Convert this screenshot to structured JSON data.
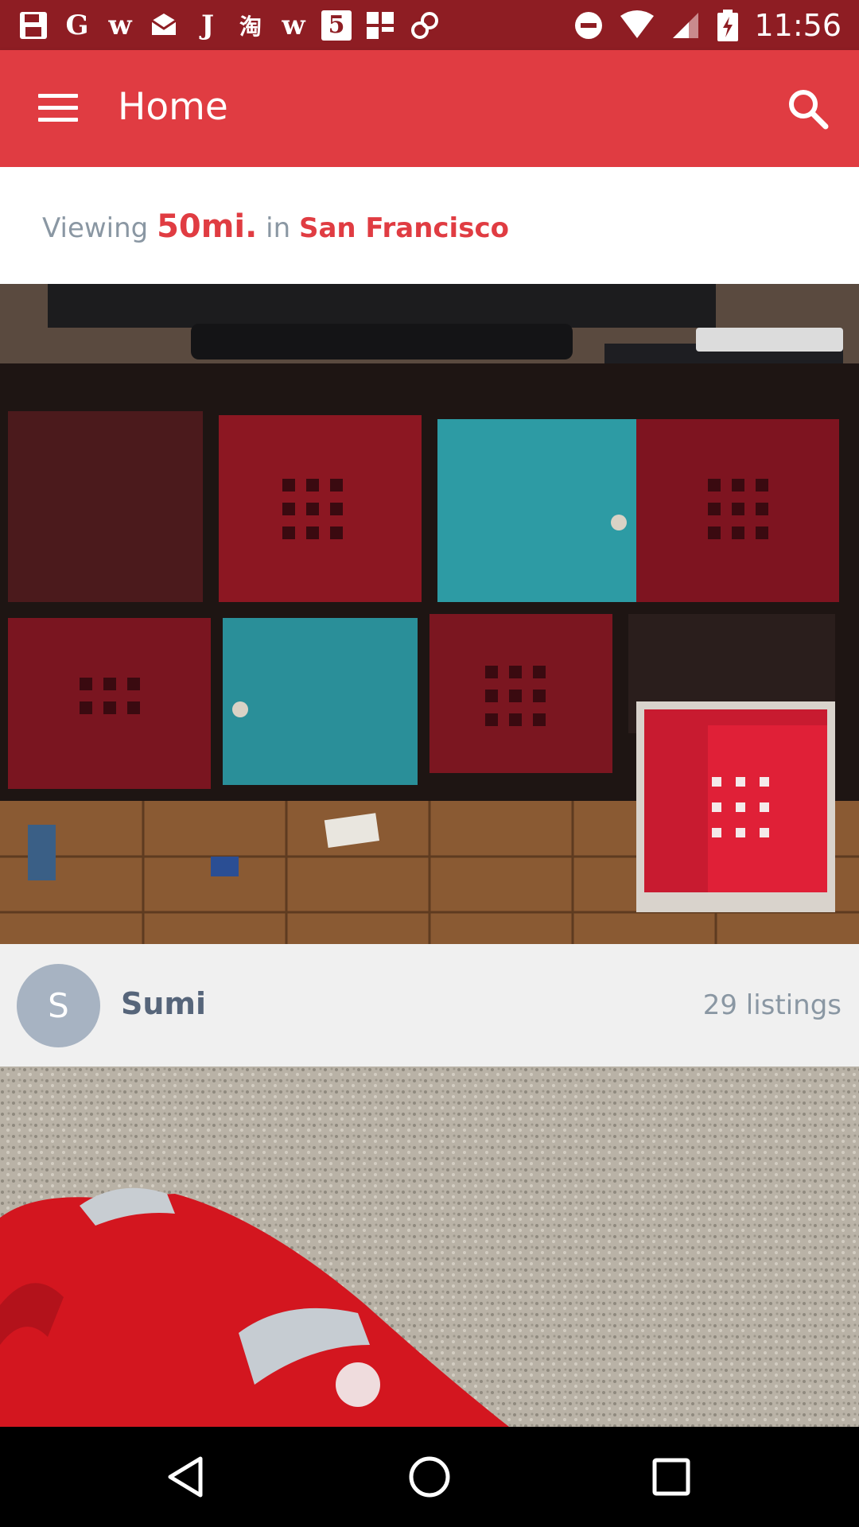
{
  "status_bar": {
    "time": "11:56",
    "notification_icons": [
      "G",
      "w",
      "J",
      "淘",
      "w",
      "5"
    ]
  },
  "app_bar": {
    "title": "Home",
    "menu_icon": "hamburger-menu-icon",
    "search_icon": "search-icon"
  },
  "location": {
    "prefix": "Viewing",
    "distance": "50mi.",
    "connector": "in",
    "city": "San Francisco"
  },
  "listings": [
    {
      "image": "photo-cube-storage-shelf",
      "seller": {
        "initial": "S",
        "name": "Sumi",
        "listings_count": "29 listings"
      }
    },
    {
      "image": "photo-handheld-vacuum"
    }
  ],
  "colors": {
    "status_bar": "#8e1d23",
    "accent": "#e03c42",
    "muted_text": "#8a97a3",
    "avatar": "#a7b3c2"
  },
  "nav_bar": {
    "back_icon": "back-triangle-icon",
    "home_icon": "home-circle-icon",
    "recents_icon": "recents-square-icon"
  }
}
